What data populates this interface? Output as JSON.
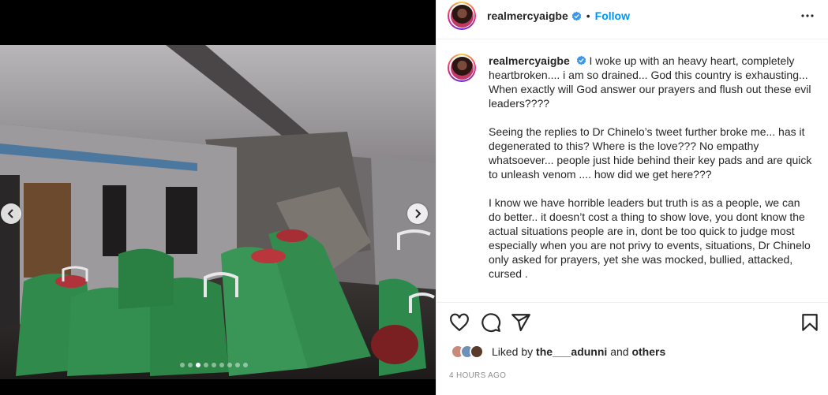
{
  "post": {
    "username": "realmercyaigbe",
    "follow_label": "Follow",
    "separator": "•"
  },
  "caption": {
    "username": "realmercyaigbe",
    "paragraphs": [
      "I woke up with an heavy heart, completely heartbroken.... i am so drained... God this country is exhausting... When exactly will God answer our prayers and flush out these evil leaders????",
      "Seeing the replies to Dr Chinelo’s tweet further broke me... has it degenerated to this? Where is the love??? No empathy whatsoever... people just hide behind their key pads and are quick to unleash venom .... how did we get here???",
      "I know we have horrible leaders but truth is as a people, we can do better.. it doesn’t cost a thing to show love, you dont know the actual situations people are in, dont be too quick to judge most especially when you are not privy to events, situations, Dr Chinelo only asked for prayers, yet she was mocked, bullied, attacked, cursed ."
    ]
  },
  "likes": {
    "prefix": "Liked by",
    "user": "the___adunni",
    "and": "and",
    "others": "others"
  },
  "timestamp": "4 HOURS AGO",
  "carousel": {
    "count": 9,
    "active_index": 2
  },
  "icons": [
    "more-icon",
    "verified-icon",
    "heart-icon",
    "comment-icon",
    "share-icon",
    "bookmark-icon",
    "chevron-left-icon",
    "chevron-right-icon"
  ],
  "colors": {
    "accent": "#0095f6",
    "verified": "#3897f0",
    "muted": "#8e8e8e"
  }
}
